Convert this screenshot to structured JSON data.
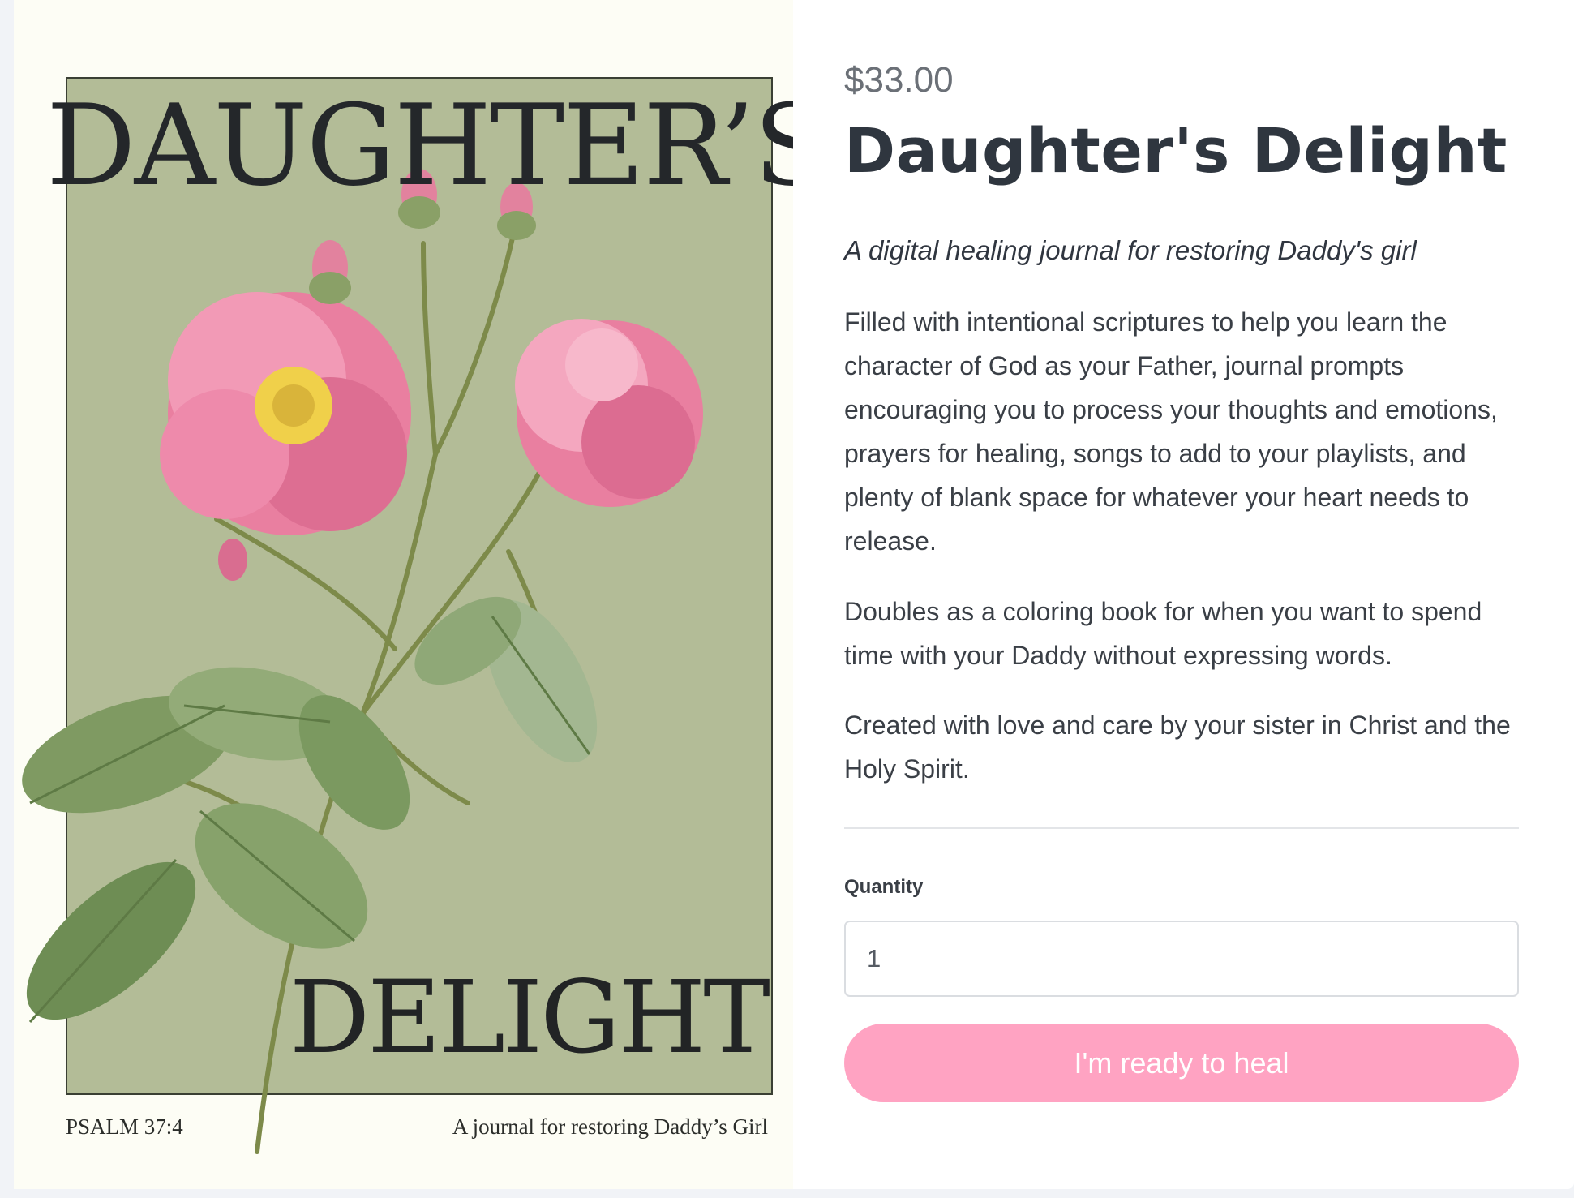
{
  "product": {
    "price": "$33.00",
    "title": "Daughter's Delight",
    "subtitle": "A digital healing journal for restoring Daddy's girl",
    "description": [
      "Filled with intentional scriptures to help you learn the character of God as your Father, journal prompts encouraging you to process your thoughts and emotions, prayers for healing, songs to add to your playlists, and plenty of blank space for whatever your heart needs to release.",
      "Doubles as a coloring book for when you want to spend time with your Daddy without expressing words.",
      "Created with love and care by your sister in Christ and the Holy Spirit."
    ],
    "quantity_label": "Quantity",
    "quantity_value": "1",
    "button_label": "I'm ready to heal"
  },
  "cover": {
    "title_top": "DAUGHTER’S",
    "title_bottom": "DELIGHT",
    "footer_left": "PSALM 37:4",
    "footer_right": "A journal for restoring Daddy’s Girl"
  },
  "colors": {
    "cover_background": "#b3bc97",
    "button": "#ffa3c2",
    "title_text": "#2f363f"
  }
}
